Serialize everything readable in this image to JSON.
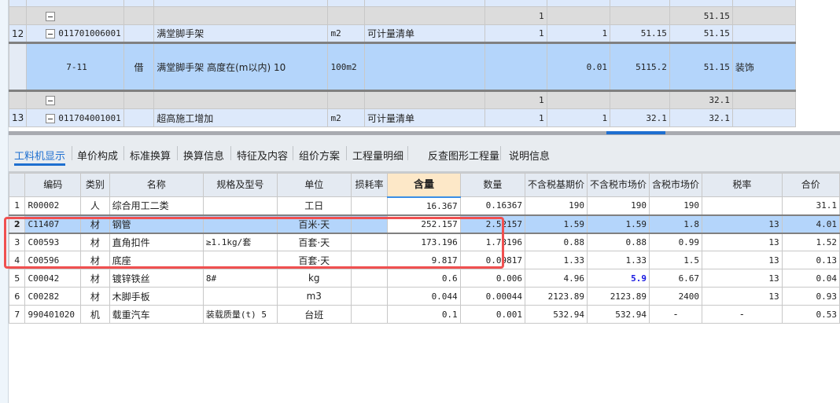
{
  "top_grid": {
    "rows": [
      {
        "num": "",
        "code": "",
        "type": "",
        "name": "",
        "unit": "",
        "category": "",
        "c1": "",
        "c2": "",
        "c3": "",
        "c4": "",
        "extra": "",
        "style": "blue"
      },
      {
        "num": "",
        "code": "",
        "type": "",
        "name": "",
        "unit": "",
        "category": "",
        "c1": "1",
        "c2": "",
        "c3": "",
        "c4": "51.15",
        "extra": "",
        "style": "gray",
        "box": true
      },
      {
        "num": "12",
        "code": "011701006001",
        "type": "",
        "name": "满堂脚手架",
        "unit": "m2",
        "category": "可计量清单",
        "c1": "1",
        "c2": "1",
        "c3": "51.15",
        "c4": "51.15",
        "extra": "",
        "style": "blue",
        "box": true
      },
      {
        "num": "",
        "code": "7-11",
        "type": "借",
        "name": "满堂脚手架 高度在(m以内) 10",
        "unit": "100m2",
        "category": "",
        "c1": "",
        "c2": "0.01",
        "c3": "5115.2",
        "c4": "51.15",
        "extra": "装饰",
        "style": "sel"
      },
      {
        "num": "",
        "code": "",
        "type": "",
        "name": "",
        "unit": "",
        "category": "",
        "c1": "1",
        "c2": "",
        "c3": "",
        "c4": "32.1",
        "extra": "",
        "style": "gray",
        "box": true
      },
      {
        "num": "13",
        "code": "011704001001",
        "type": "",
        "name": "超高施工增加",
        "unit": "m2",
        "category": "可计量清单",
        "c1": "1",
        "c2": "1",
        "c3": "32.1",
        "c4": "32.1",
        "extra": "",
        "style": "blue",
        "box": true
      }
    ]
  },
  "tabs": [
    "工料机显示",
    "单价构成",
    "标准换算",
    "换算信息",
    "特征及内容",
    "组价方案",
    "工程量明细",
    "反查图形工程量",
    "说明信息"
  ],
  "active_tab": "工料机显示",
  "materials": {
    "headers": [
      "",
      "编码",
      "类别",
      "名称",
      "规格及型号",
      "单位",
      "损耗率",
      "含量",
      "数量",
      "不含税基期价",
      "不含税市场价",
      "含税市场价",
      "税率",
      "合价"
    ],
    "rows": [
      [
        "1",
        "R00002",
        "人",
        "综合用工二类",
        "",
        "工日",
        "",
        "16.367",
        "0.16367",
        "190",
        "190",
        "190",
        "",
        "31.1"
      ],
      [
        "2",
        "C11407",
        "材",
        "钢管",
        "",
        "百米·天",
        "",
        "252.157",
        "2.52157",
        "1.59",
        "1.59",
        "1.8",
        "13",
        "4.01"
      ],
      [
        "3",
        "C00593",
        "材",
        "直角扣件",
        "≥1.1kg/套",
        "百套·天",
        "",
        "173.196",
        "1.73196",
        "0.88",
        "0.88",
        "0.99",
        "13",
        "1.52"
      ],
      [
        "4",
        "C00596",
        "材",
        "底座",
        "",
        "百套·天",
        "",
        "9.817",
        "0.09817",
        "1.33",
        "1.33",
        "1.5",
        "13",
        "0.13"
      ],
      [
        "5",
        "C00042",
        "材",
        "镀锌铁丝",
        "8#",
        "kg",
        "",
        "0.6",
        "0.006",
        "4.96",
        "5.9",
        "6.67",
        "13",
        "0.04"
      ],
      [
        "6",
        "C00282",
        "材",
        "木脚手板",
        "",
        "m3",
        "",
        "0.044",
        "0.00044",
        "2123.89",
        "2123.89",
        "2400",
        "13",
        "0.93"
      ],
      [
        "7",
        "990401020",
        "机",
        "载重汽车",
        "装载质量(t) 5",
        "台班",
        "",
        "0.1",
        "0.001",
        "532.94",
        "532.94",
        "-",
        "-",
        "0.53"
      ]
    ],
    "selected_row": "2",
    "highlight_value_color": "#1515e0",
    "annotation_color": "#f05050"
  }
}
